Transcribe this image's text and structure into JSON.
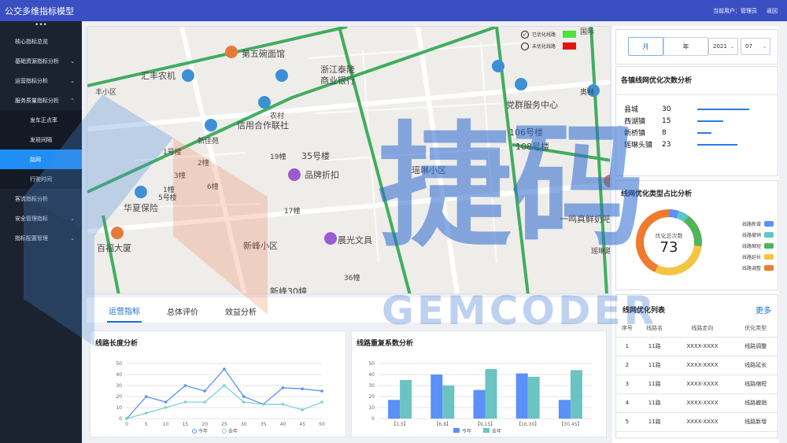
{
  "app": {
    "title": "公交多维指标模型",
    "user_label": "当前用户：管理员",
    "back_label": "返回"
  },
  "sidebar": {
    "collapse_label": "•••",
    "items": [
      {
        "label": "核心指标总览",
        "chevron": ""
      },
      {
        "label": "基础资源指标分析",
        "chevron": "⌄"
      },
      {
        "label": "运营指标分析",
        "chevron": "⌄"
      },
      {
        "label": "服务质量指标分析",
        "chevron": "⌃"
      },
      {
        "label": "发车正点率",
        "sub": true
      },
      {
        "label": "发班间隔",
        "sub": true
      },
      {
        "label": "路网",
        "sub": true,
        "active": true
      },
      {
        "label": "行驶时间",
        "sub": true
      },
      {
        "label": "客流指标分析",
        "chevron": ""
      },
      {
        "label": "安全管理指标",
        "chevron": "⌄"
      },
      {
        "label": "指标配置管理",
        "chevron": "⌄"
      }
    ]
  },
  "map": {
    "legend": [
      {
        "label": "已优化线路",
        "color": "#4de23a",
        "checked": true
      },
      {
        "label": "未优化线路",
        "color": "#e31414",
        "checked": false
      }
    ],
    "labels": [
      "第五碗面馆",
      "浙江泰隆",
      "商业银行",
      "汇丰农机",
      "丰小区",
      "农村",
      "信用合作联社",
      "新佳苑",
      "1号楼",
      "2幢",
      "3幢",
      "1幢",
      "5号楼",
      "6幢",
      "19幢",
      "35号楼",
      "品牌折扣",
      "瑶琳小区",
      "党群服务中心",
      "106号楼",
      "108号楼",
      "华夏保险",
      "17幢",
      "一鸣真鲜奶吧",
      "百福大厦",
      "晨光文具",
      "新峰小区",
      "36幢",
      "新峰30幢",
      "奥林",
      "国际",
      "瑶琳路"
    ]
  },
  "tabs": [
    {
      "label": "运营指标",
      "active": true
    },
    {
      "label": "总体评价",
      "active": false
    },
    {
      "label": "效益分析",
      "active": false
    }
  ],
  "filters": {
    "month_label": "月",
    "year_label": "年",
    "year_value": "2021",
    "month_value": "07"
  },
  "town_card": {
    "title": "各镇线网优化次数分析",
    "rows": [
      {
        "name": "县城",
        "count": 30
      },
      {
        "name": "西湖镇",
        "count": 15
      },
      {
        "name": "新桥镇",
        "count": 8
      },
      {
        "name": "瑶琳头镇",
        "count": 23
      }
    ]
  },
  "donut_card": {
    "title": "线网优化类型占比分析",
    "center_label": "优化总次数",
    "center_value": "73",
    "legend": [
      "线路新增",
      "线路撤销",
      "线路缩短",
      "线路延长",
      "线路调整"
    ]
  },
  "list_card": {
    "title": "线网优化列表",
    "more_label": "更多",
    "headers": [
      "序号",
      "线路名",
      "线路走向",
      "优化类型"
    ],
    "rows": [
      [
        "1",
        "11路",
        "XXXX-XXXX",
        "线路调整"
      ],
      [
        "2",
        "11路",
        "XXXX-XXXX",
        "线路延长"
      ],
      [
        "3",
        "11路",
        "XXXX-XXXX",
        "线路缩短"
      ],
      [
        "4",
        "11路",
        "XXXX-XXXX",
        "线路撤销"
      ],
      [
        "5",
        "11路",
        "XXXX-XXXX",
        "线路新增"
      ]
    ]
  },
  "chart_data": [
    {
      "type": "line",
      "title": "线路长度分析",
      "x": [
        0,
        5,
        10,
        15,
        20,
        25,
        30,
        35,
        40,
        45,
        50
      ],
      "ylim": [
        0,
        50
      ],
      "yticks": [
        0,
        10,
        20,
        30,
        40,
        50
      ],
      "series": [
        {
          "name": "今年",
          "color": "#5b8ff9",
          "values": [
            0,
            20,
            15,
            30,
            25,
            45,
            20,
            13,
            28,
            27,
            25
          ]
        },
        {
          "name": "去年",
          "color": "#7fd0d4",
          "values": [
            0,
            5,
            10,
            15,
            15,
            30,
            15,
            13,
            13,
            8,
            15
          ]
        }
      ]
    },
    {
      "type": "bar",
      "title": "线路重复系数分析",
      "categories": [
        "【1,5】",
        "【6,8】",
        "【9,15】",
        "【16,30】",
        "【30,45】"
      ],
      "ylim": [
        0,
        50
      ],
      "yticks": [
        0,
        10,
        20,
        30,
        40,
        50
      ],
      "series": [
        {
          "name": "今年",
          "color": "#5b8ff9",
          "values": [
            17,
            40,
            26,
            41,
            17
          ]
        },
        {
          "name": "去年",
          "color": "#6cc3c3",
          "values": [
            35,
            30,
            45,
            38,
            44
          ]
        }
      ]
    }
  ],
  "watermark": {
    "big": "捷码",
    "sub": "GEMCODER"
  },
  "colors": {
    "topbar": "#3a4fc2",
    "sidebar": "#1c2330",
    "accent": "#1f8ef5",
    "donut": [
      "#5b8ff9",
      "#5ac8c8",
      "#52b35a",
      "#f4c542",
      "#f07b2d"
    ]
  }
}
